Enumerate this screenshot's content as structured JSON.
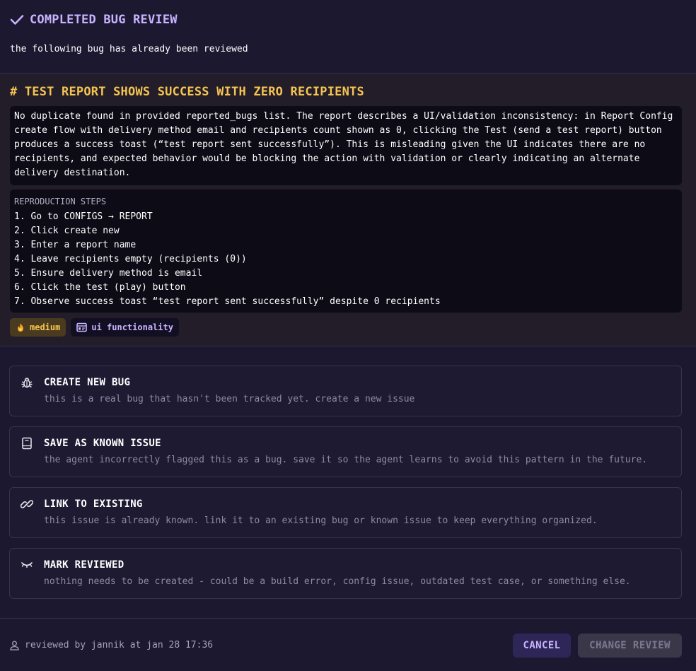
{
  "header": {
    "title": "COMPLETED BUG REVIEW",
    "subtitle": "the following bug has already been reviewed"
  },
  "bug": {
    "title": "# TEST REPORT SHOWS SUCCESS WITH ZERO RECIPIENTS",
    "description": "No duplicate found in provided reported_bugs list. The report describes a UI/validation inconsistency: in Report Config create flow with delivery method email and recipients count shown as 0, clicking the Test (send a test report) button produces a success toast (“test report sent successfully”). This is misleading given the UI indicates there are no recipients, and expected behavior would be blocking the action with validation or clearly indicating an alternate delivery destination.",
    "steps_heading": "REPRODUCTION STEPS",
    "steps": [
      "1. Go to CONFIGS → REPORT",
      "2. Click create new",
      "3. Enter a report name",
      "4. Leave recipients empty (recipients (0))",
      "5. Ensure delivery method is email",
      "6. Click the test (play) button",
      "7. Observe success toast “test report sent successfully” despite 0 recipients"
    ],
    "tags": {
      "severity": "medium",
      "category": "ui functionality"
    }
  },
  "options": [
    {
      "icon": "bug-icon",
      "title": "CREATE NEW BUG",
      "desc": "this is a real bug that hasn't been tracked yet. create a new issue"
    },
    {
      "icon": "book-icon",
      "title": "SAVE AS KNOWN ISSUE",
      "desc": "the agent incorrectly flagged this as a bug. save it so the agent learns to avoid this pattern in the future."
    },
    {
      "icon": "link-icon",
      "title": "LINK TO EXISTING",
      "desc": "this issue is already known. link it to an existing bug or known issue to keep everything organized."
    },
    {
      "icon": "closed-eye-icon",
      "title": "MARK REVIEWED",
      "desc": "nothing needs to be created - could be a build error, config issue, outdated test case, or something else."
    }
  ],
  "footer": {
    "reviewed_by": "reviewed by jannik at jan 28 17:36",
    "cancel_label": "CANCEL",
    "change_label": "CHANGE REVIEW"
  },
  "colors": {
    "accent": "#c9b3ff",
    "warning": "#f5c451",
    "background": "#1b1830"
  }
}
